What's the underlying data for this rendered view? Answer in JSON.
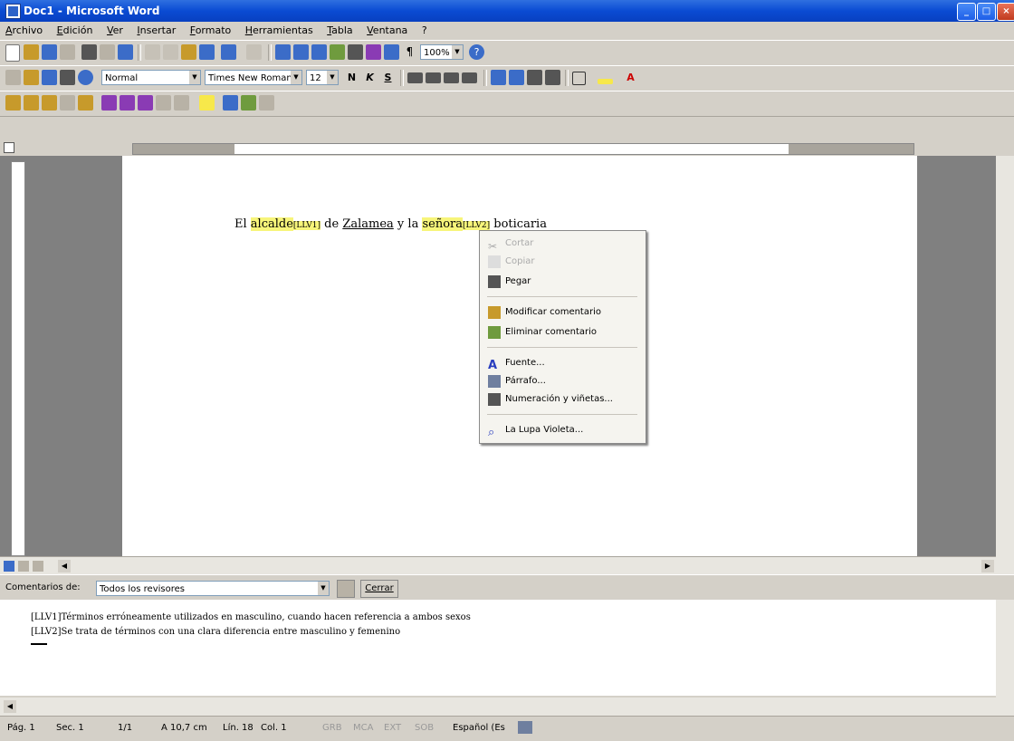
{
  "window": {
    "title": "Doc1 - Microsoft Word",
    "controls": {
      "minimize": "_",
      "maximize": "□",
      "close": "×"
    }
  },
  "menubar": {
    "items": [
      "Archivo",
      "Edición",
      "Ver",
      "Insertar",
      "Formato",
      "Herramientas",
      "Tabla",
      "Ventana",
      "?"
    ]
  },
  "toolbar_standard": {
    "zoom": "100%",
    "help_label": "?"
  },
  "toolbar_format": {
    "style": "Normal",
    "font": "Times New Roman",
    "size": "12",
    "bold": "N",
    "italic": "K",
    "underline": "S"
  },
  "document": {
    "text_before": "El ",
    "word1": "alcalde",
    "mark1": "[LLV1]",
    "text_middle": " de ",
    "place": "Zalamea",
    "text_middle2": " y la ",
    "word2": "señora",
    "mark2": "[LLV2]",
    "text_after": " boticaria"
  },
  "context_menu": {
    "items": [
      {
        "label": "Cortar",
        "icon": "scissors-icon",
        "enabled": false
      },
      {
        "label": "Copiar",
        "icon": "copy-icon",
        "enabled": false
      },
      {
        "label": "Pegar",
        "icon": "paste-icon",
        "enabled": true
      },
      {
        "label": "Modificar comentario",
        "icon": "edit-comment-icon",
        "enabled": true
      },
      {
        "label": "Eliminar comentario",
        "icon": "delete-comment-icon",
        "enabled": true
      },
      {
        "label": "Fuente...",
        "icon": "font-icon",
        "enabled": true
      },
      {
        "label": "Párrafo...",
        "icon": "paragraph-icon",
        "enabled": true
      },
      {
        "label": "Numeración y viñetas...",
        "icon": "bullets-icon",
        "enabled": true
      },
      {
        "label": "La Lupa Violeta...",
        "icon": "magnifier-icon",
        "enabled": true
      }
    ]
  },
  "comments_pane": {
    "label": "Comentarios de:",
    "reviewers": "Todos los revisores",
    "close_label": "Cerrar",
    "comments": [
      "[LLV1]Términos erróneamente utilizados en masculino, cuando hacen referencia a ambos sexos",
      "[LLV2]Se trata de términos con una clara diferencia entre masculino y femenino"
    ]
  },
  "status_bar": {
    "page": "Pág. 1",
    "section": "Sec. 1",
    "pages": "1/1",
    "position": "A 10,7 cm",
    "line": "Lín. 18",
    "column": "Col. 1",
    "modes": [
      "GRB",
      "MCA",
      "EXT",
      "SOB"
    ],
    "language": "Español (Es"
  },
  "colors": {
    "titlebar": "#0a4bd3",
    "highlight": "#f7f57a",
    "chrome": "#d4d0c8"
  }
}
